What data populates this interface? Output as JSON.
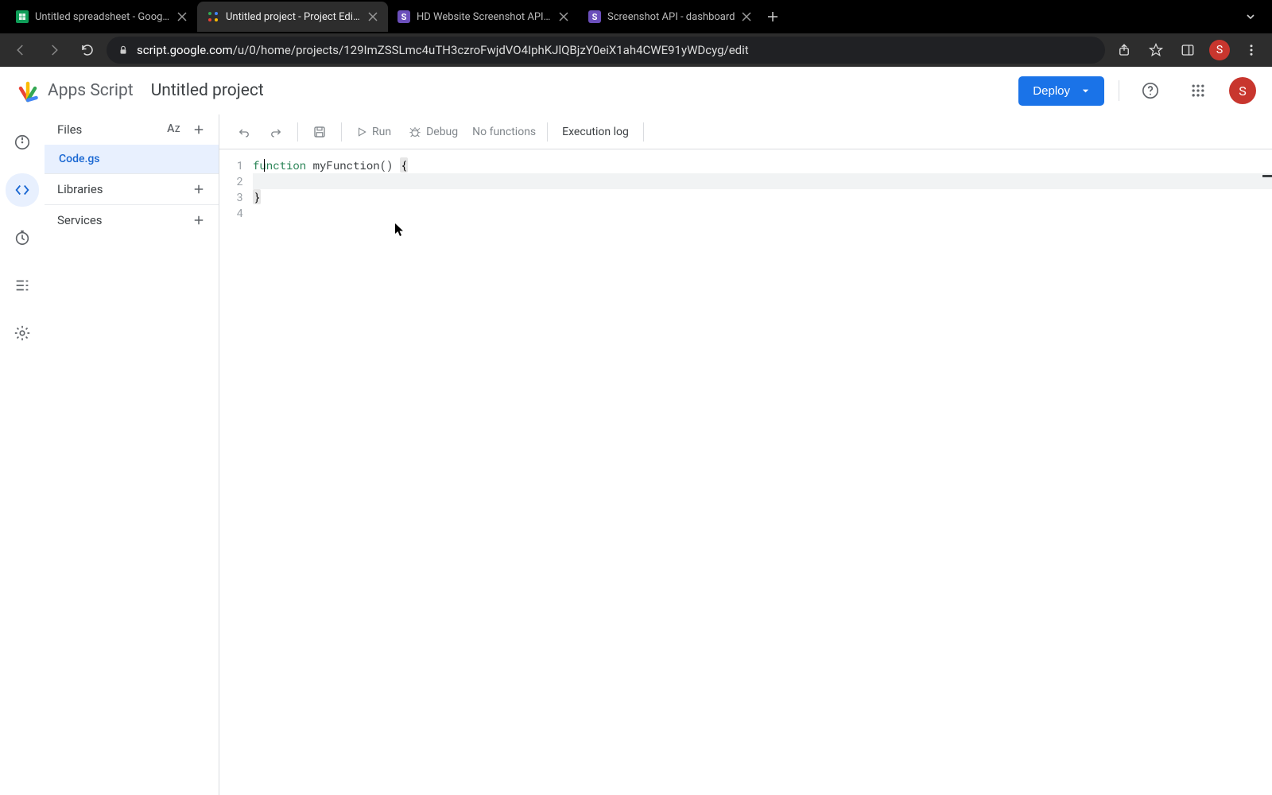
{
  "browser": {
    "tabs": [
      {
        "title": "Untitled spreadsheet - Google",
        "favicon": "sheets"
      },
      {
        "title": "Untitled project - Project Edito",
        "favicon": "apps-script",
        "active": true
      },
      {
        "title": "HD Website Screenshot API | S",
        "favicon": "s-purple"
      },
      {
        "title": "Screenshot API - dashboard",
        "favicon": "s-purple"
      }
    ],
    "url": "script.google.com/u/0/home/projects/129ImZSSLmc4uTH3czroFwjdVO4IphKJlQBjzY0eiX1ah4CWE91yWDcyg/edit",
    "domain": "script.google.com",
    "path": "/u/0/home/projects/129ImZSSLmc4uTH3czroFwjdVO4IphKJlQBjzY0eiX1ah4CWE91yWDcyg/edit",
    "profile_letter": "S"
  },
  "header": {
    "app_name": "Apps Script",
    "project_title": "Untitled project",
    "deploy_label": "Deploy",
    "avatar_letter": "S"
  },
  "files_panel": {
    "files_label": "Files",
    "file_name": "Code.gs",
    "libraries_label": "Libraries",
    "services_label": "Services"
  },
  "editor_toolbar": {
    "run_label": "Run",
    "debug_label": "Debug",
    "function_select": "No functions",
    "execution_log_label": "Execution log"
  },
  "code": {
    "lines": {
      "1": "1",
      "2": "2",
      "3": "3",
      "4": "4"
    },
    "kw_function": "function",
    "fn_name": " myFunction() ",
    "open_brace": "{",
    "close_brace": "}"
  }
}
